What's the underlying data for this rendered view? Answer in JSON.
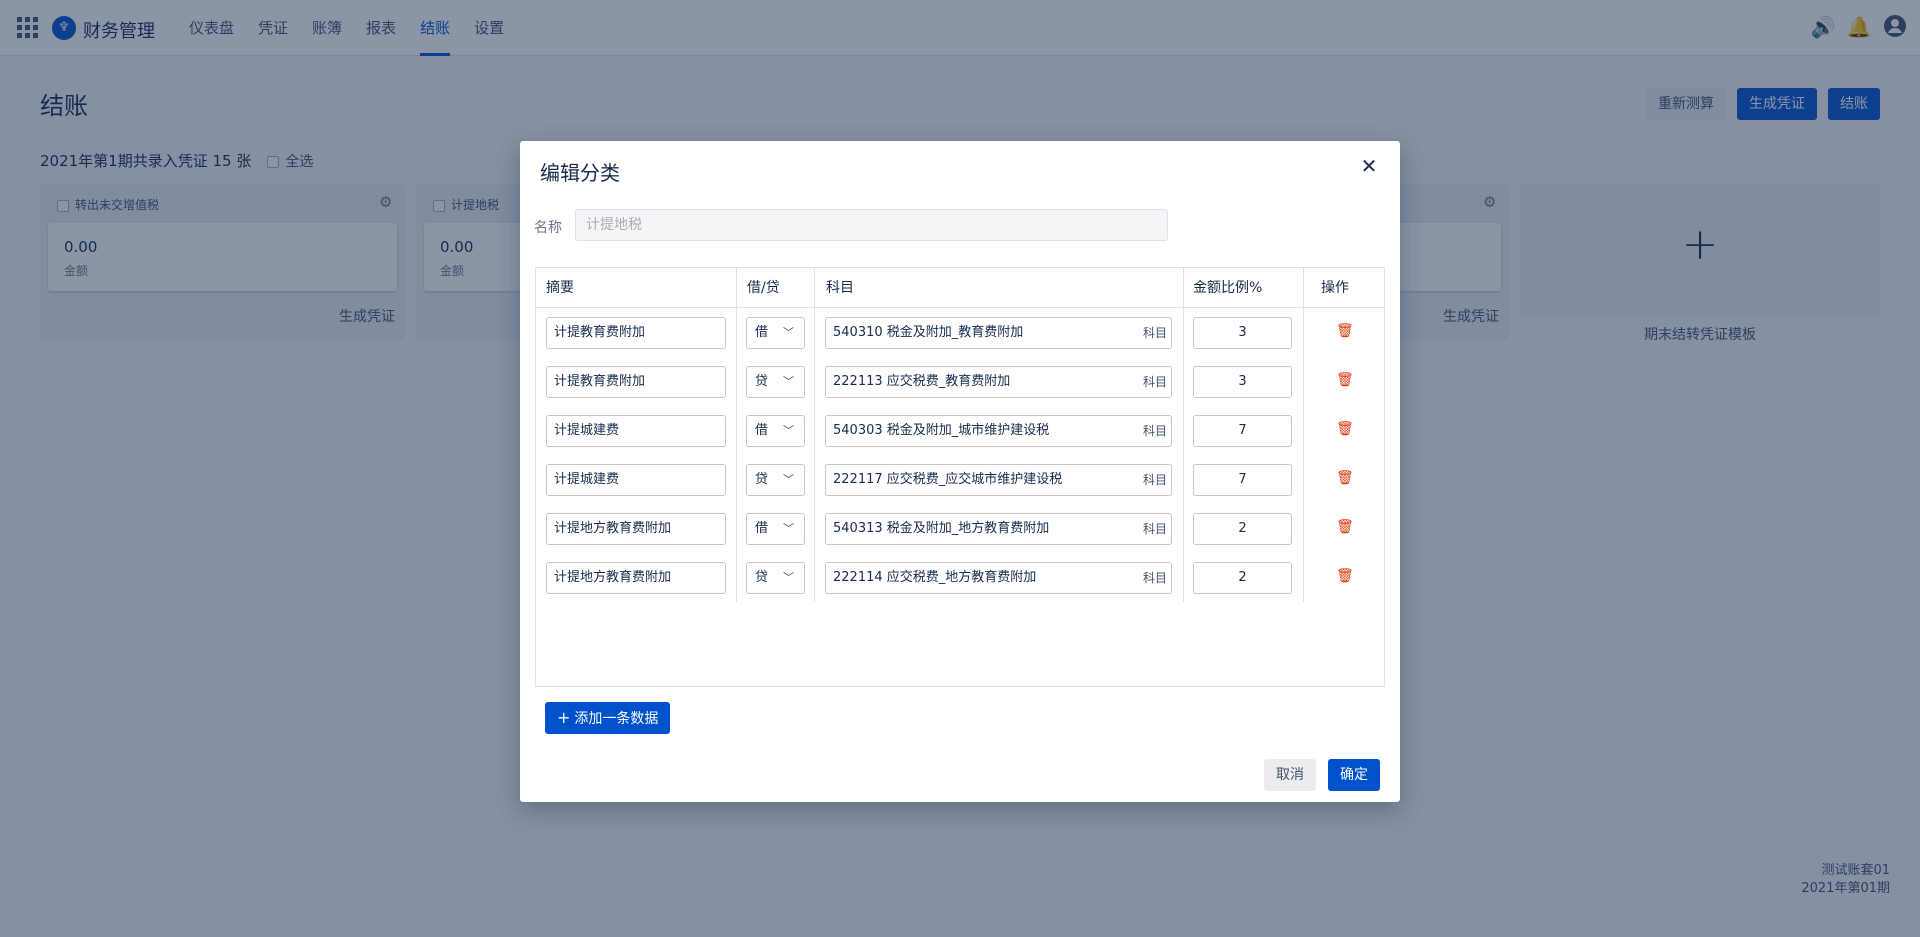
{
  "app": {
    "name": "财务管理",
    "logo_glyph": "♆"
  },
  "nav": [
    {
      "label": "仪表盘",
      "active": false
    },
    {
      "label": "凭证",
      "active": false
    },
    {
      "label": "账簿",
      "active": false
    },
    {
      "label": "报表",
      "active": false
    },
    {
      "label": "结账",
      "active": true
    },
    {
      "label": "设置",
      "active": false
    }
  ],
  "topbar_icons": [
    "speaker-icon",
    "bell-icon",
    "user-avatar-icon"
  ],
  "page": {
    "title": "结账",
    "actions": {
      "recalc": "重新测算",
      "generate": "生成凭证",
      "close": "结账"
    },
    "summary": "2021年第1期共录入凭证 15 张",
    "select_all": "全选",
    "cards": [
      {
        "title": "转出未交增值税",
        "amount": "0.00",
        "amount_label": "金额",
        "footer": "生成凭证"
      },
      {
        "title": "计提地税",
        "amount": "0.00",
        "amount_label": "金额",
        "footer": ""
      },
      {
        "title": "",
        "amount": "",
        "amount_label": "",
        "footer": "生成凭证"
      }
    ],
    "add_template_label": "期末结转凭证模板",
    "footer": {
      "account_set": "测试账套01",
      "period": "2021年第01期"
    }
  },
  "modal": {
    "title": "编辑分类",
    "name_label": "名称",
    "name_placeholder": "计提地税",
    "columns": {
      "summary": "摘要",
      "dc": "借/贷",
      "account": "科目",
      "ratio": "金额比例%",
      "action": "操作"
    },
    "account_tag": "科目",
    "rows": [
      {
        "summary": "计提教育费附加",
        "dc": "借",
        "account": "540310 税金及附加_教育费附加",
        "ratio": "3"
      },
      {
        "summary": "计提教育费附加",
        "dc": "贷",
        "account": "222113 应交税费_教育费附加",
        "ratio": "3"
      },
      {
        "summary": "计提城建费",
        "dc": "借",
        "account": "540303 税金及附加_城市维护建设税",
        "ratio": "7"
      },
      {
        "summary": "计提城建费",
        "dc": "贷",
        "account": "222117 应交税费_应交城市维护建设税",
        "ratio": "7"
      },
      {
        "summary": "计提地方教育费附加",
        "dc": "借",
        "account": "540313 税金及附加_地方教育费附加",
        "ratio": "2"
      },
      {
        "summary": "计提地方教育费附加",
        "dc": "贷",
        "account": "222114 应交税费_地方教育费附加",
        "ratio": "2"
      }
    ],
    "add_row": "添加一条数据",
    "cancel": "取消",
    "confirm": "确定"
  },
  "colors": {
    "primary": "#0052cc",
    "danger": "#de350b",
    "overlay": "rgba(23,43,77,0.5)"
  }
}
